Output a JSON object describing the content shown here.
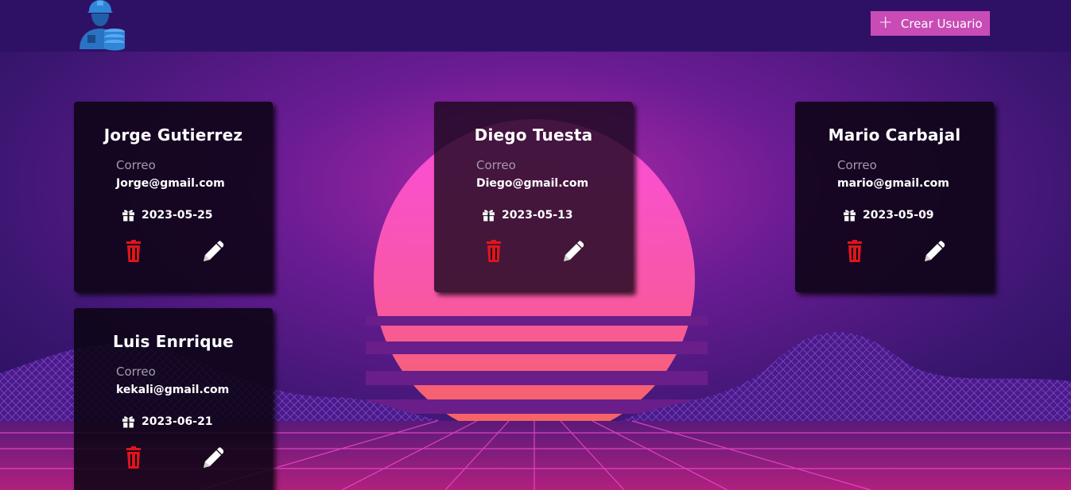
{
  "header": {
    "logo_icon": "engineer-database-icon",
    "create_button": {
      "label": "Crear Usuario",
      "icon": "plus-icon"
    }
  },
  "field_labels": {
    "email": "Correo"
  },
  "users": [
    {
      "name": "Jorge Gutierrez",
      "email": "Jorge@gmail.com",
      "date": "2023-05-25"
    },
    {
      "name": "Diego Tuesta",
      "email": "Diego@gmail.com",
      "date": "2023-05-13"
    },
    {
      "name": "Mario Carbajal",
      "email": "mario@gmail.com",
      "date": "2023-05-09"
    },
    {
      "name": "Luis Enrrique",
      "email": "kekali@gmail.com",
      "date": "2023-06-21"
    }
  ],
  "icons": {
    "date": "gift-icon",
    "delete": "trash-icon",
    "edit": "pencil-icon"
  },
  "colors": {
    "topbar": "#2e1165",
    "accent_button": "#c84bb6",
    "delete_icon": "#e0151c",
    "card_bg": "#0a0412"
  }
}
